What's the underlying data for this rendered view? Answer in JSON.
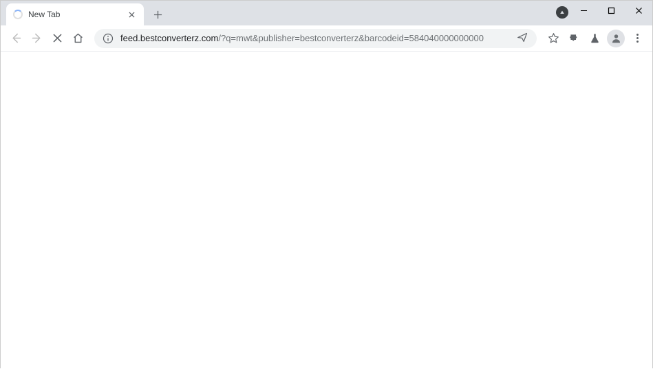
{
  "tab": {
    "title": "New Tab"
  },
  "omnibox": {
    "domain": "feed.bestconverterz.com",
    "path": "/?q=mwt&publisher=bestconverterz&barcodeid=584040000000000"
  }
}
